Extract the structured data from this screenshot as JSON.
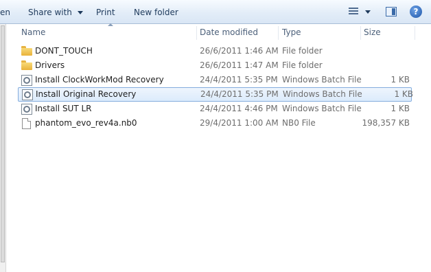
{
  "toolbar": {
    "open_partial": "en",
    "share_with": "Share with",
    "print": "Print",
    "new_folder": "New folder",
    "help_glyph": "?"
  },
  "columns": {
    "name": "Name",
    "date_modified": "Date modified",
    "type": "Type",
    "size": "Size"
  },
  "files": [
    {
      "name": "DONT_TOUCH",
      "date": "26/6/2011 1:46 AM",
      "type": "File folder",
      "size": "",
      "icon": "folder-icon"
    },
    {
      "name": "Drivers",
      "date": "26/6/2011 1:47 AM",
      "type": "File folder",
      "size": "",
      "icon": "folder-icon"
    },
    {
      "name": "Install ClockWorkMod Recovery",
      "date": "24/4/2011 5:35 PM",
      "type": "Windows Batch File",
      "size": "1 KB",
      "icon": "batch-file-icon"
    },
    {
      "name": "Install Original Recovery",
      "date": "24/4/2011 5:35 PM",
      "type": "Windows Batch File",
      "size": "1 KB",
      "icon": "batch-file-icon",
      "selected": true
    },
    {
      "name": "Install SUT LR",
      "date": "24/4/2011 4:46 PM",
      "type": "Windows Batch File",
      "size": "1 KB",
      "icon": "batch-file-icon"
    },
    {
      "name": "phantom_evo_rev4a.nb0",
      "date": "29/4/2011 1:00 AM",
      "type": "NB0 File",
      "size": "198,357 KB",
      "icon": "file-icon"
    }
  ]
}
